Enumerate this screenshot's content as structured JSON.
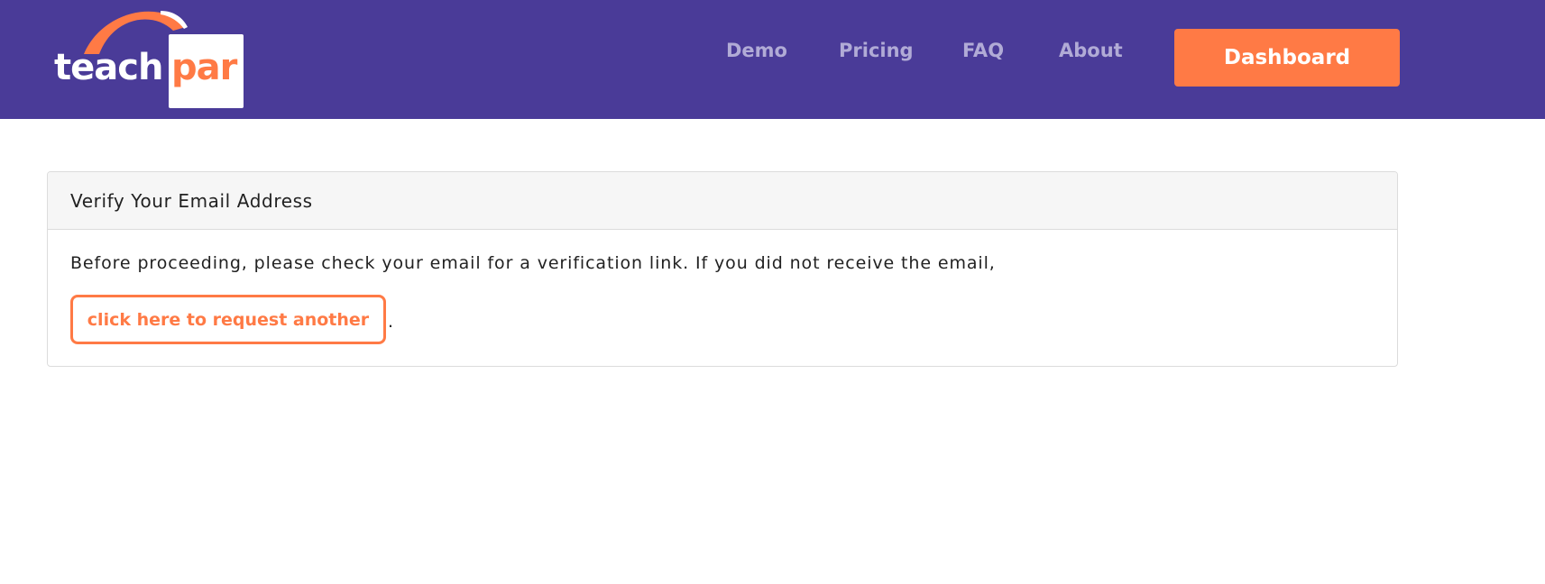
{
  "header": {
    "logo": {
      "text_teach": "teach",
      "text_par": "par"
    },
    "nav": {
      "demo": "Demo",
      "pricing": "Pricing",
      "faq": "FAQ",
      "about": "About"
    },
    "dashboard_label": "Dashboard"
  },
  "card": {
    "title": "Verify Your Email Address",
    "body_text": "Before proceeding, please check your email for a verification link. If you did not receive the email,",
    "resend_label": "click here to request another",
    "trailing_period": "."
  },
  "colors": {
    "navbar_bg": "#4a3b98",
    "accent": "#ff7a45",
    "nav_link": "#b1abd6",
    "card_header_bg": "#f6f6f6"
  }
}
